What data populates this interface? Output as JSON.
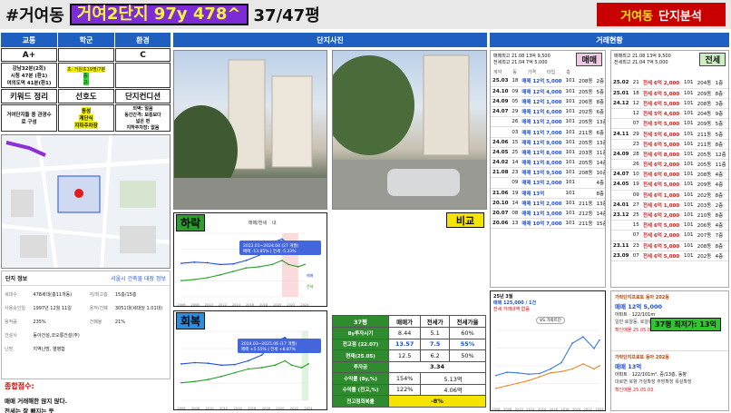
{
  "title": {
    "area": "#거여동",
    "complex": "거여2단지 97y 478^",
    "size": "37/47평",
    "analysis_region": "거여동",
    "analysis_label": "단지분석"
  },
  "grid_headers": [
    "교통",
    "학군",
    "환경"
  ],
  "grades": [
    "A+",
    "",
    "C"
  ],
  "transport": [
    "강남32분(2회)",
    "시청 47분 (환1)",
    "여의도역 41분(환1)"
  ],
  "school": {
    "line1": "초: 거원초19명/7분",
    "line2": "중:",
    "line3": "고:"
  },
  "keyword_headers": [
    "키워드 정리",
    "선호도",
    "단지컨디션"
  ],
  "keywords": {
    "text": "거여단지들 중 관광수로 구성",
    "preference": [
      "동성",
      "계단식",
      "지하주차장"
    ],
    "condition": [
      "외벽: 얼음",
      "동간간격: 보통보다",
      "넓은 편",
      "지하주차장: 없음"
    ]
  },
  "complex_info": {
    "header": "단지 정보",
    "link": "서울시 건축물 대장 정보",
    "rows": [
      {
        "k1": "세대수",
        "v1": "478세대(총11개동)",
        "k2": "저/최고층",
        "v2": "15층/15층"
      },
      {
        "k1": "사용승인일",
        "v1": "1997년 12월 11일",
        "k2": "용적/건폐",
        "v2": "3051대(세대당 1.01대)"
      },
      {
        "k1": "용적률",
        "v1": "235%",
        "k2": "건폐율",
        "v2": "21%"
      },
      {
        "k1": "건설사",
        "v1": "동아건설,코오롱건설(주)",
        "k2": "",
        "v2": ""
      },
      {
        "k1": "난방",
        "v1": "지역난방, 열병합",
        "k2": "",
        "v2": ""
      }
    ]
  },
  "summary": {
    "title": "종합점수:",
    "line1": "매매 거래해한 않지 않다.",
    "line2": "전세는 잘 빠지는 듯"
  },
  "photos_header": "단지사진",
  "trade_header": "거래현황",
  "drop_label": "하락",
  "recover_label": "회복",
  "compare_label": "비교",
  "drop_chart": {
    "tab1": "매매/전세",
    "tab2": "내",
    "legend_sale": "매매",
    "legend_jeonse": "전세",
    "tooltip_line1": "2022.01~2024.04 (27 개월)",
    "tooltip_line2": "매매 -13.85%  |  전세 -5.33%",
    "x_ticks": [
      "2006",
      "2008",
      "2010",
      "2012",
      "2014",
      "2016",
      "2018",
      "2020",
      "2022",
      "2024"
    ]
  },
  "recover_chart": {
    "tooltip_line1": "2024.03~2025.06 (17 개월)",
    "tooltip_line2": "매매 +5.55%  |  전세 +8.87%",
    "x_ticks": [
      "2006",
      "2008",
      "2010",
      "2012",
      "2014",
      "2016",
      "2018",
      "2020",
      "2022",
      "2024"
    ]
  },
  "compare_table": {
    "headers": [
      "37평",
      "매매가",
      "전세가",
      "전세가율"
    ],
    "rows": [
      [
        "8y투자시기",
        "8.44",
        "5.1",
        "60%"
      ],
      [
        "전고점 (22.07)",
        "13.57",
        "7.5",
        "55%"
      ],
      [
        "현재(25.05)",
        "12.5",
        "6.2",
        "50%"
      ],
      [
        "투자금",
        "3.34",
        "",
        ""
      ],
      [
        "수익률 (8y,%)",
        "154%",
        "5.13억",
        ""
      ],
      [
        "수익률 (전고,%)",
        "122%",
        "4.06억",
        ""
      ],
      [
        "전고점회복률",
        "-8%",
        "",
        ""
      ]
    ]
  },
  "sale_panel": {
    "head_line1": "매매최고 21.08 13억 9,500",
    "head_line2": "전세최고 21.04 7억 5,000",
    "tag": "매매",
    "col_headers": [
      "계약",
      "동",
      "가격",
      "타입",
      "층"
    ],
    "rows": [
      [
        "25.03",
        "18",
        "매매 12억 5,000",
        "101",
        "208동",
        "2층"
      ],
      [
        "24.10",
        "09",
        "매매 12억 4,000",
        "101",
        "205동",
        "5층"
      ],
      [
        "24.09",
        "05",
        "매매 12억 1,000",
        "101",
        "206동",
        "8층"
      ],
      [
        "24.07",
        "29",
        "매매 11억 6,000",
        "101",
        "202동",
        "6층"
      ],
      [
        "",
        "26",
        "매매 11억 2,000",
        "101",
        "205동",
        "13층"
      ],
      [
        "",
        "03",
        "매매 11억 7,000",
        "101",
        "211동",
        "6층"
      ],
      [
        "24.06",
        "15",
        "매매 11억 9,000",
        "101",
        "205동",
        "13층"
      ],
      [
        "24.05",
        "25",
        "매매 11억 8,000",
        "101",
        "203동",
        "11층"
      ],
      [
        "24.02",
        "14",
        "매매 11억 8,000",
        "101",
        "205동",
        "14층"
      ],
      [
        "21.08",
        "23",
        "매매 13억 9,500",
        "101",
        "208동",
        "10층"
      ],
      [
        "",
        "09",
        "매매 13억 2,000",
        "101",
        "",
        "4층"
      ],
      [
        "21.06",
        "19",
        "매매 13억",
        "101",
        "",
        "8층"
      ],
      [
        "20.10",
        "14",
        "매매 11억 2,000",
        "101",
        "211동",
        "13층"
      ],
      [
        "20.07",
        "08",
        "매매 11억 3,000",
        "101",
        "212동",
        "14층"
      ],
      [
        "20.06",
        "13",
        "매매 10억 7,000",
        "101",
        "211동",
        "15층"
      ]
    ]
  },
  "jeonse_panel": {
    "head_line1": "매매최고 21.08 13억 9,500",
    "head_line2": "전세최고 21.04 7억 5,000",
    "tag": "전세",
    "rows": [
      [
        "25.02",
        "21",
        "전세 6억 2,000",
        "101",
        "204동",
        "1층"
      ],
      [
        "25.01",
        "18",
        "전세 6억 5,000",
        "101",
        "209동",
        "8층"
      ],
      [
        "24.12",
        "12",
        "전세 6억 5,000",
        "101",
        "208동",
        "3층"
      ],
      [
        "",
        "12",
        "전세 5억 4,600",
        "101",
        "204동",
        "9층"
      ],
      [
        "",
        "07",
        "전세 5억 5,000",
        "101",
        "209동",
        "5층"
      ],
      [
        "24.11",
        "29",
        "전세 5억 6,000",
        "101",
        "211동",
        "5층"
      ],
      [
        "",
        "23",
        "전세 6억 5,000",
        "101",
        "211동",
        "8층"
      ],
      [
        "24.09",
        "28",
        "전세 6억 8,000",
        "101",
        "205동",
        "12층"
      ],
      [
        "",
        "26",
        "전세 6억 2,000",
        "101",
        "205동",
        "11층"
      ],
      [
        "24.07",
        "10",
        "전세 6억 0,000",
        "101",
        "208동",
        "4층"
      ],
      [
        "24.05",
        "19",
        "전세 6억 5,000",
        "101",
        "209동",
        "4층"
      ],
      [
        "",
        "09",
        "전세 6억 1,000",
        "101",
        "202동",
        "8층"
      ],
      [
        "24.01",
        "27",
        "전세 6억 1,000",
        "101",
        "203동",
        "2층"
      ],
      [
        "23.12",
        "25",
        "전세 6억 2,000",
        "101",
        "210동",
        "8층"
      ],
      [
        "",
        "15",
        "전세 6억 5,000",
        "101",
        "206동",
        "4층"
      ],
      [
        "",
        "07",
        "전세 6억 2,000",
        "101",
        "207동",
        "7층"
      ],
      [
        "23.11",
        "23",
        "전세 6억 5,000",
        "101",
        "208동",
        "8층"
      ],
      [
        "23.09",
        "07",
        "전세 6억 5,000",
        "101",
        "202동",
        "4층"
      ]
    ]
  },
  "price_chart": {
    "period": "25년 3월",
    "sale": "매매 125,000 / 1건",
    "note": "전세 거래내역 없음",
    "compare_tag": "VS 가락트단",
    "x_ticks": [
      "2006",
      "2008",
      "2010",
      "2012",
      "2014",
      "2016",
      "2018",
      "2020",
      "2022",
      "2024"
    ]
  },
  "listings": [
    {
      "name": "가락단지프로토 동아 202동",
      "line1": "매매 12억 5,000",
      "line2": "아파트 · 122/101m",
      "line3": "일반 로얄동, 로얄층 중층, 지하주차장",
      "date": "확인매물 25.05.03."
    },
    {
      "name": "가락단지프로토 동아 202동",
      "line1": "매매 13억",
      "line2": "아파트 · 122/101m², 중/13층, 동향",
      "line3": "대로변 북향 거실확장 주방확장 욕실확장",
      "date": "확인매물 25.05.03."
    }
  ],
  "lowest_badge": "37평 최저가: 13억",
  "chart_data": [
    {
      "type": "line",
      "title": "매매/전세",
      "xlabel": "",
      "ylabel": "",
      "x": [
        2006,
        2008,
        2010,
        2012,
        2014,
        2016,
        2018,
        2020,
        2021.5,
        2022.5,
        2024,
        2025
      ],
      "series": [
        {
          "name": "매매",
          "values": [
            58,
            60,
            59,
            56,
            57,
            63,
            72,
            94,
            100,
            92,
            85,
            88
          ]
        },
        {
          "name": "전세",
          "values": [
            28,
            30,
            33,
            38,
            44,
            50,
            52,
            56,
            63,
            56,
            52,
            56
          ]
        }
      ],
      "ylim": [
        0,
        110
      ],
      "grid": true
    },
    {
      "type": "line",
      "title": "",
      "xlabel": "",
      "ylabel": "",
      "x": [
        2006,
        2008,
        2010,
        2012,
        2014,
        2016,
        2018,
        2020,
        2021.5,
        2022.5,
        2024,
        2025
      ],
      "series": [
        {
          "name": "매매",
          "values": [
            58,
            60,
            59,
            56,
            57,
            63,
            72,
            94,
            100,
            92,
            85,
            90
          ]
        },
        {
          "name": "전세",
          "values": [
            28,
            30,
            33,
            38,
            44,
            50,
            52,
            56,
            63,
            56,
            52,
            58
          ]
        }
      ],
      "ylim": [
        0,
        110
      ],
      "grid": true
    },
    {
      "type": "line",
      "title": "25년 3월",
      "xlabel": "",
      "ylabel": "",
      "x": [
        2006,
        2008,
        2010,
        2012,
        2014,
        2016,
        2018,
        2020,
        2022,
        2024,
        2025
      ],
      "series": [
        {
          "name": "매매",
          "values": [
            40,
            45,
            44,
            42,
            43,
            50,
            60,
            90,
            100,
            82,
            95
          ]
        },
        {
          "name": "전세",
          "values": [
            20,
            24,
            28,
            32,
            38,
            44,
            46,
            50,
            58,
            50,
            55
          ]
        }
      ],
      "ylim": [
        0,
        110
      ],
      "grid": true
    }
  ]
}
